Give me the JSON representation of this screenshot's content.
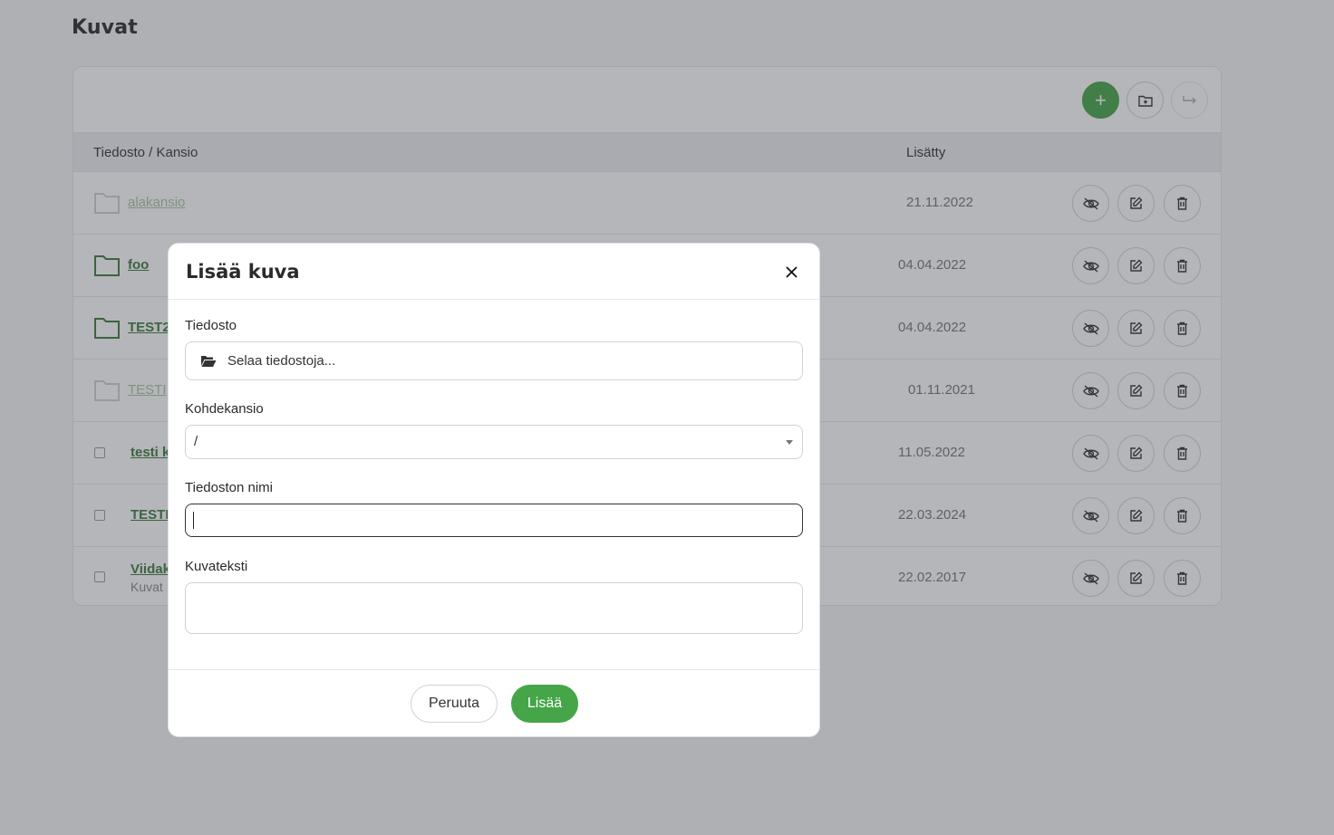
{
  "page": {
    "title": "Kuvat"
  },
  "table": {
    "col_name": "Tiedosto / Kansio",
    "col_date": "Lisätty",
    "rows": [
      {
        "type": "folder",
        "name": "alakansio",
        "date": "21.11.2022",
        "hidden": true
      },
      {
        "type": "folder",
        "name": "foo",
        "date": "04.04.2022",
        "hidden": false
      },
      {
        "type": "folder",
        "name": "TEST2",
        "date": "04.04.2022",
        "hidden": false
      },
      {
        "type": "folder",
        "name": "TESTI",
        "date": "01.11.2021",
        "hidden": true
      },
      {
        "type": "file",
        "name": "testi k",
        "date": "11.05.2022",
        "hidden": false
      },
      {
        "type": "file",
        "name": "TESTI",
        "date": "22.03.2024",
        "hidden": false
      },
      {
        "type": "file",
        "name": "Viidak",
        "sub": "Kuvat",
        "date": "22.02.2017",
        "hidden": false
      }
    ]
  },
  "toolbar": {
    "add_symbol": "+"
  },
  "modal": {
    "title": "Lisää kuva",
    "file_label": "Tiedosto",
    "file_placeholder": "Selaa tiedostoja...",
    "folder_label": "Kohdekansio",
    "folder_value": "/",
    "filename_label": "Tiedoston nimi",
    "filename_value": "",
    "caption_label": "Kuvateksti",
    "caption_value": "",
    "cancel_label": "Peruuta",
    "submit_label": "Lisää"
  },
  "colors": {
    "accent": "#46a548",
    "link": "#3d7a3e"
  },
  "icons": [
    "plus-icon",
    "folder-plus-icon",
    "move-icon",
    "folder-icon",
    "eye-slash-icon",
    "edit-icon",
    "trash-icon",
    "close-icon",
    "folder-open-icon"
  ]
}
